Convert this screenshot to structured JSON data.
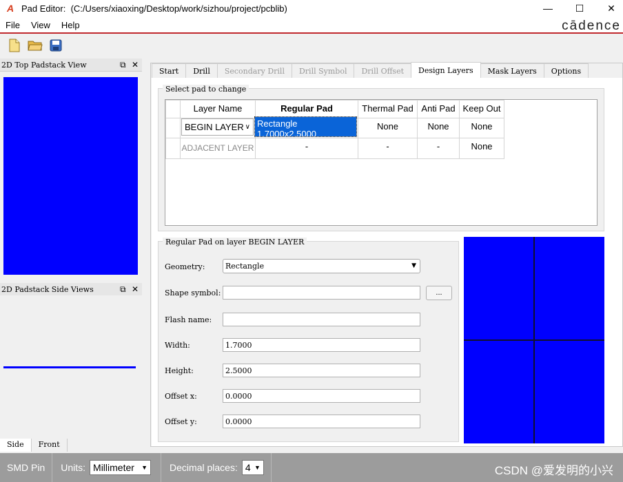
{
  "window": {
    "title": "Pad Editor:",
    "path": "(C:/Users/xiaoxing/Desktop/work/sizhou/project/pcblib)",
    "minimize": "—",
    "maximize": "☐",
    "close": "✕",
    "app_icon": "cadence-a-icon"
  },
  "menu": {
    "file": "File",
    "view": "View",
    "help": "Help",
    "brand": "cādence"
  },
  "toolbar": {
    "icons": [
      "new-file-icon",
      "open-folder-icon",
      "save-icon"
    ]
  },
  "left": {
    "top_view_title": "2D Top Padstack View",
    "side_view_title": "2D Padstack Side Views",
    "side_tabs": [
      "Side",
      "Front"
    ],
    "dock_float": "⧉",
    "dock_close": "✕"
  },
  "tabs": [
    "Start",
    "Drill",
    "Secondary Drill",
    "Drill Symbol",
    "Drill Offset",
    "Design Layers",
    "Mask Layers",
    "Options"
  ],
  "select_group": {
    "label": "Select pad to change",
    "headers": [
      "Layer Name",
      "Regular Pad",
      "Thermal Pad",
      "Anti Pad",
      "Keep Out"
    ],
    "rows": [
      {
        "layer": "BEGIN LAYER",
        "regular": "Rectangle 1.7000x2.5000",
        "thermal": "None",
        "anti": "None",
        "keepout": "None"
      },
      {
        "layer": "ADJACENT LAYER",
        "regular": "-",
        "thermal": "-",
        "anti": "-",
        "keepout": "None"
      }
    ]
  },
  "pad_group": {
    "label": "Regular Pad on layer BEGIN LAYER",
    "geometry_label": "Geometry:",
    "geometry_value": "Rectangle",
    "shape_label": "Shape symbol:",
    "shape_value": "",
    "browse": "...",
    "flash_label": "Flash name:",
    "flash_value": "",
    "width_label": "Width:",
    "width_value": "1.7000",
    "height_label": "Height:",
    "height_value": "2.5000",
    "offx_label": "Offset x:",
    "offx_value": "0.0000",
    "offy_label": "Offset y:",
    "offy_value": "0.0000"
  },
  "status": {
    "type": "SMD Pin",
    "units_label": "Units:",
    "units_value": "Millimeter",
    "decimal_label": "Decimal places:",
    "decimal_value": "4"
  },
  "watermark": "CSDN @爱发明的小兴",
  "colors": {
    "pad": "#0000ff",
    "accent": "#c0282d",
    "selection": "#0a64d8"
  }
}
